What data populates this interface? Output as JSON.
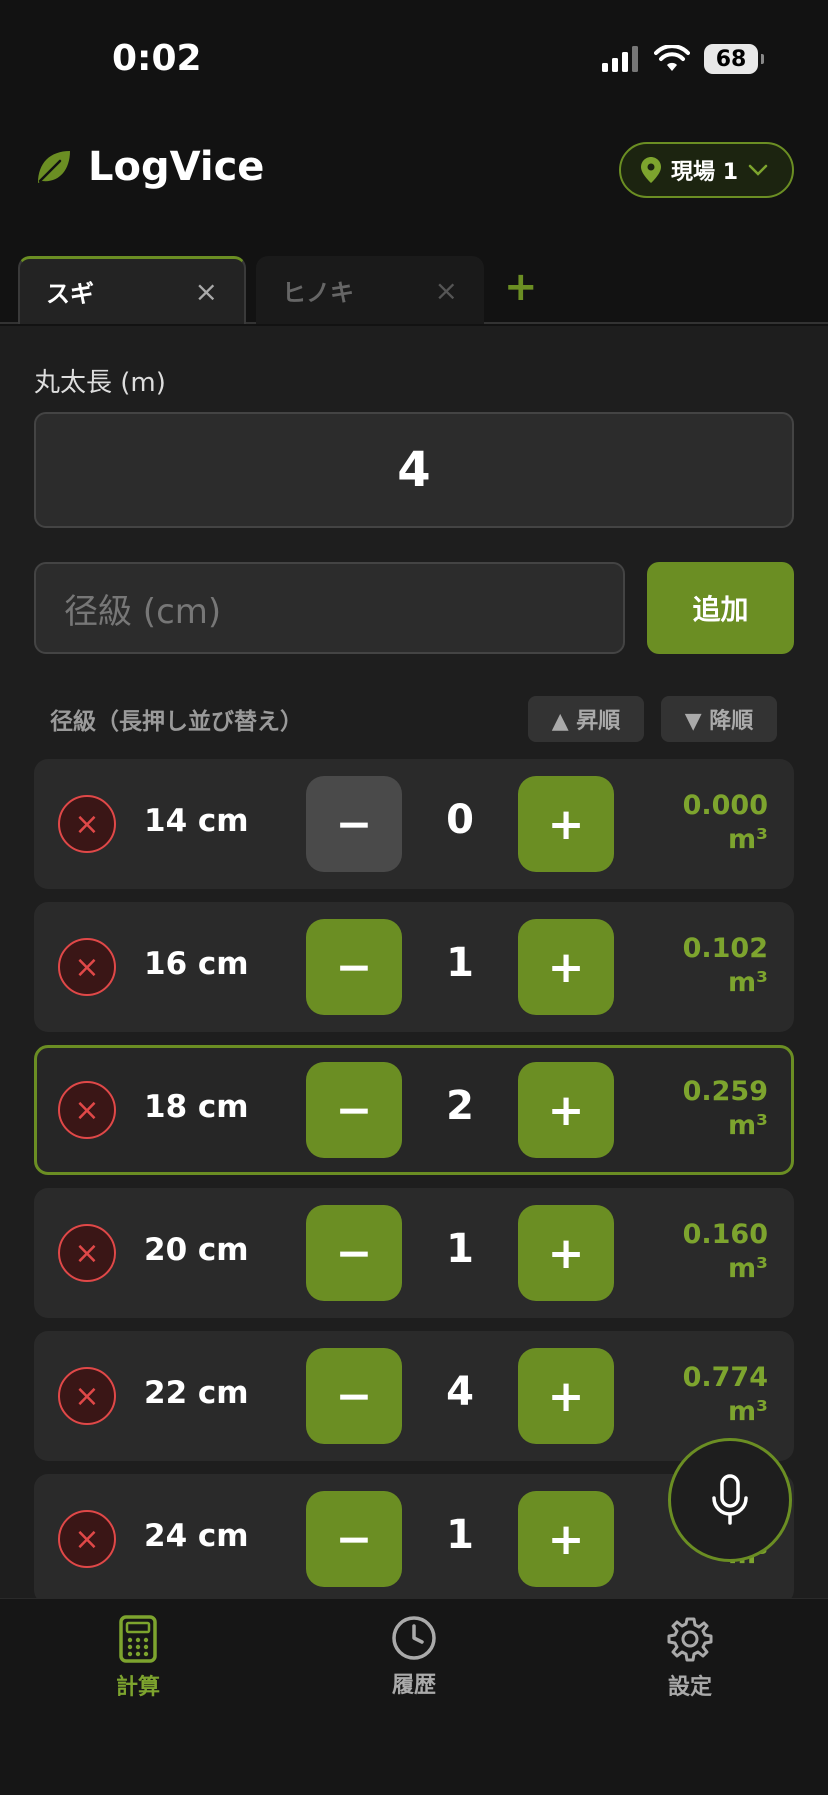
{
  "status_bar": {
    "time": "0:02",
    "battery": "68"
  },
  "header": {
    "app_name": "LogVice",
    "site_selector": "現場 1"
  },
  "tabs": [
    {
      "label": "スギ",
      "active": true
    },
    {
      "label": "ヒノキ",
      "active": false
    }
  ],
  "form": {
    "length_label": "丸太長 (m)",
    "length_value": "4",
    "diameter_placeholder": "径級 (cm)",
    "add_label": "追加"
  },
  "list": {
    "label": "径級（長押し並び替え）",
    "sort_asc": "▲ 昇順",
    "sort_desc": "▼ 降順",
    "rows": [
      {
        "size": "14 cm",
        "count": "0",
        "volume": "0.000",
        "unit": "m³",
        "minus_disabled": true
      },
      {
        "size": "16 cm",
        "count": "1",
        "volume": "0.102",
        "unit": "m³"
      },
      {
        "size": "18 cm",
        "count": "2",
        "volume": "0.259",
        "unit": "m³",
        "highlight": true
      },
      {
        "size": "20 cm",
        "count": "1",
        "volume": "0.160",
        "unit": "m³"
      },
      {
        "size": "22 cm",
        "count": "4",
        "volume": "0.774",
        "unit": "m³"
      },
      {
        "size": "24 cm",
        "count": "1",
        "volume": "",
        "unit": "m³"
      }
    ],
    "minus_symbol": "−",
    "plus_symbol": "+",
    "delete_symbol": "×"
  },
  "nav": {
    "calc": "計算",
    "history": "履歴",
    "settings": "設定"
  },
  "colors": {
    "accent": "#6b8e23",
    "danger": "#e04848",
    "background": "#121212"
  }
}
